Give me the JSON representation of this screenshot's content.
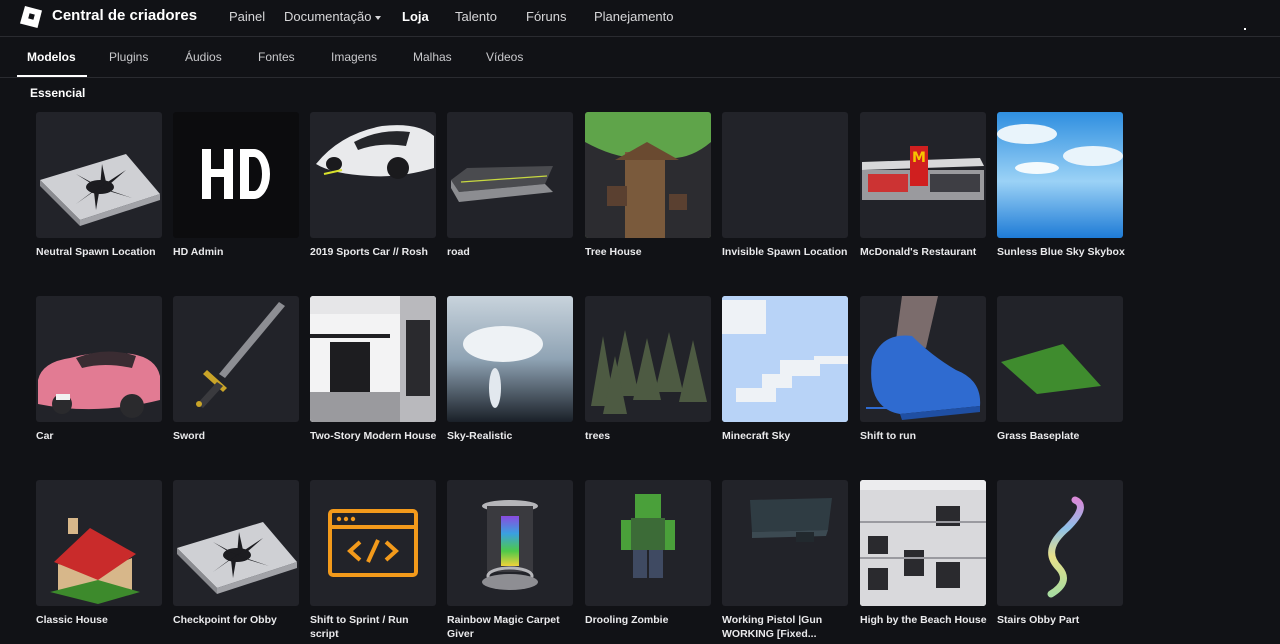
{
  "header": {
    "brand": "Central de criadores",
    "nav": [
      {
        "label": "Painel"
      },
      {
        "label": "Documentação"
      },
      {
        "label": "Loja"
      },
      {
        "label": "Talento"
      },
      {
        "label": "Fóruns"
      },
      {
        "label": "Planejamento"
      }
    ]
  },
  "tabs": [
    {
      "label": "Modelos"
    },
    {
      "label": "Plugins"
    },
    {
      "label": "Áudios"
    },
    {
      "label": "Fontes"
    },
    {
      "label": "Imagens"
    },
    {
      "label": "Malhas"
    },
    {
      "label": "Vídeos"
    }
  ],
  "section_title": "Essencial",
  "items": [
    {
      "name": "Neutral Spawn Location",
      "icon": "spawn-pad-icon"
    },
    {
      "name": "HD Admin",
      "icon": "hd-admin-icon"
    },
    {
      "name": "2019 Sports Car // Rosh",
      "icon": "sports-car-icon"
    },
    {
      "name": "road",
      "icon": "road-icon"
    },
    {
      "name": "Tree House",
      "icon": "tree-house-icon"
    },
    {
      "name": "Invisible Spawn Location",
      "icon": "invisible-spawn-icon"
    },
    {
      "name": "McDonald's Restaurant",
      "icon": "restaurant-icon"
    },
    {
      "name": "Sunless Blue Sky Skybox",
      "icon": "blue-sky-icon"
    },
    {
      "name": "Car",
      "icon": "pink-car-icon"
    },
    {
      "name": "Sword",
      "icon": "sword-icon"
    },
    {
      "name": "Two-Story Modern House",
      "icon": "modern-house-icon"
    },
    {
      "name": "Sky-Realistic",
      "icon": "realistic-sky-icon"
    },
    {
      "name": "trees",
      "icon": "trees-icon"
    },
    {
      "name": "Minecraft Sky",
      "icon": "minecraft-sky-icon"
    },
    {
      "name": "Shift to run",
      "icon": "shoe-icon"
    },
    {
      "name": "Grass Baseplate",
      "icon": "grass-baseplate-icon"
    },
    {
      "name": "Classic House",
      "icon": "classic-house-icon"
    },
    {
      "name": "Checkpoint for Obby",
      "icon": "checkpoint-pad-icon"
    },
    {
      "name": "Shift to Sprint / Run script",
      "icon": "code-script-icon"
    },
    {
      "name": "Rainbow Magic Carpet Giver",
      "icon": "carpet-giver-icon"
    },
    {
      "name": "Drooling Zombie",
      "icon": "zombie-icon"
    },
    {
      "name": "Working Pistol |Gun WORKING [Fixed...",
      "icon": "pistol-icon"
    },
    {
      "name": "High by the Beach House",
      "icon": "beach-house-icon"
    },
    {
      "name": "Stairs Obby Part",
      "icon": "rainbow-stairs-icon"
    }
  ]
}
